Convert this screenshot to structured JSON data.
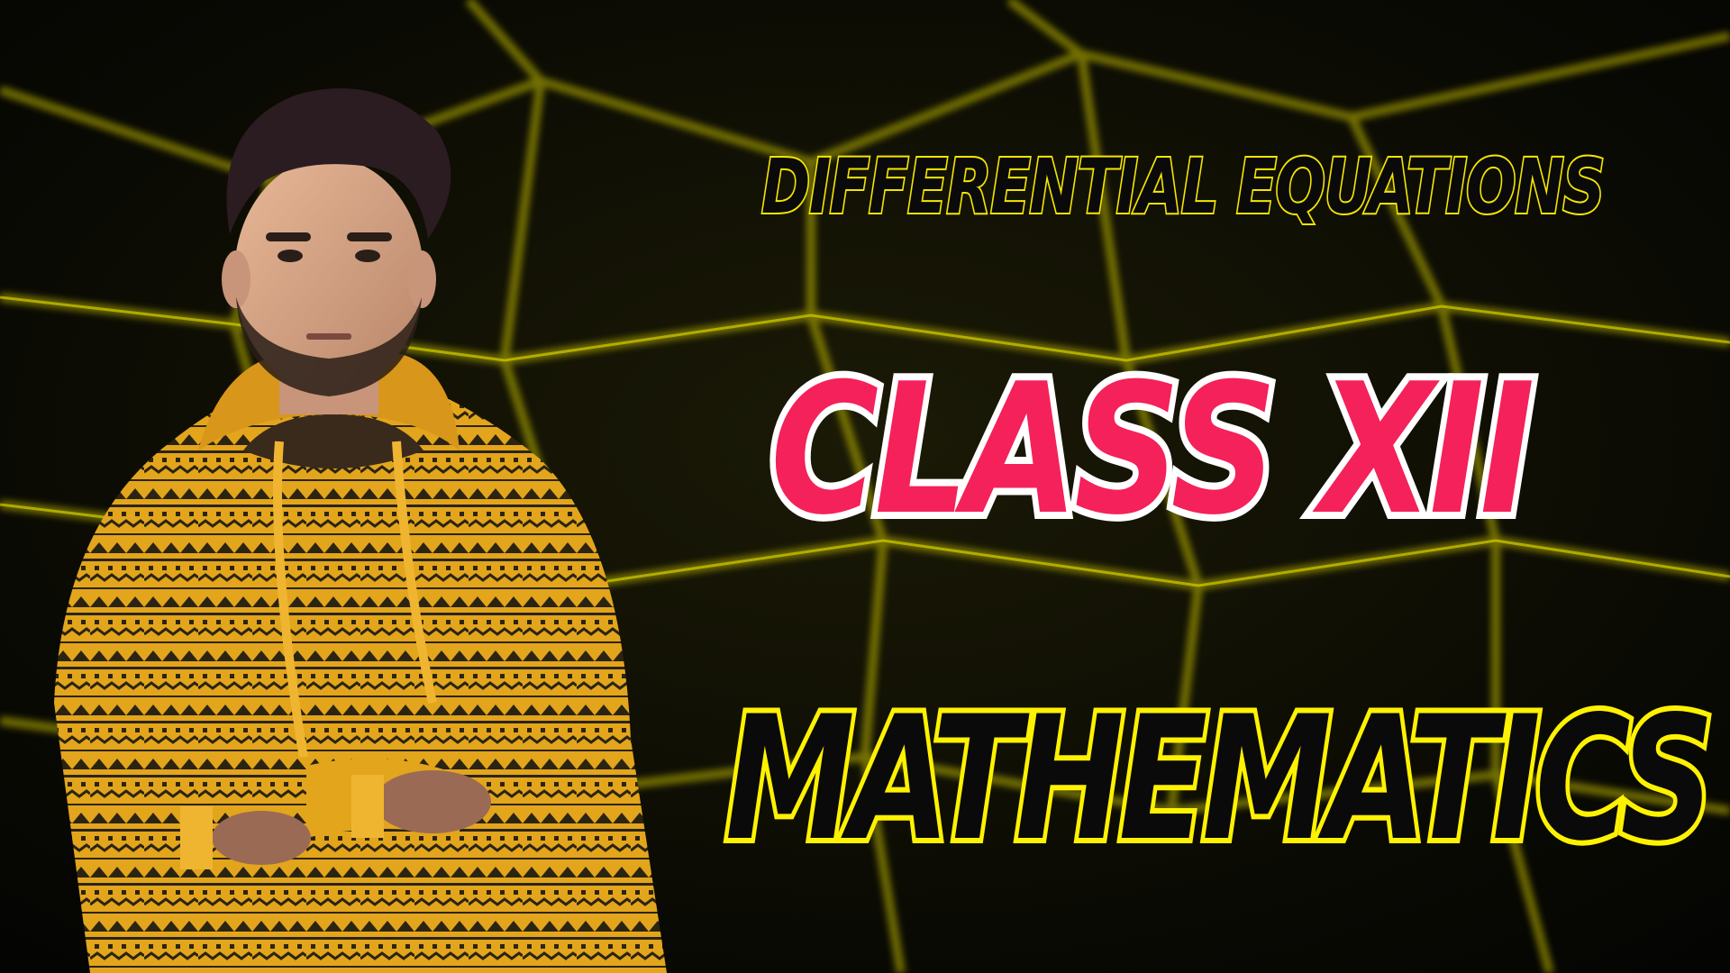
{
  "colors": {
    "background": "#050505",
    "hex_grid": "#c9c200",
    "hoodie": "#e3a51c",
    "hoodie_pattern": "#2b2413",
    "accent_yellow": "#fff200",
    "accent_pink": "#f4215a",
    "white": "#ffffff"
  },
  "texts": {
    "topic": "DIFFERENTIAL EQUATIONS",
    "class": "CLASS XII",
    "subject": "MATHEMATICS"
  },
  "icons": {
    "background": "yellow-hexagon-grid",
    "presenter": "man-in-yellow-patterned-hoodie-arms-crossed"
  }
}
